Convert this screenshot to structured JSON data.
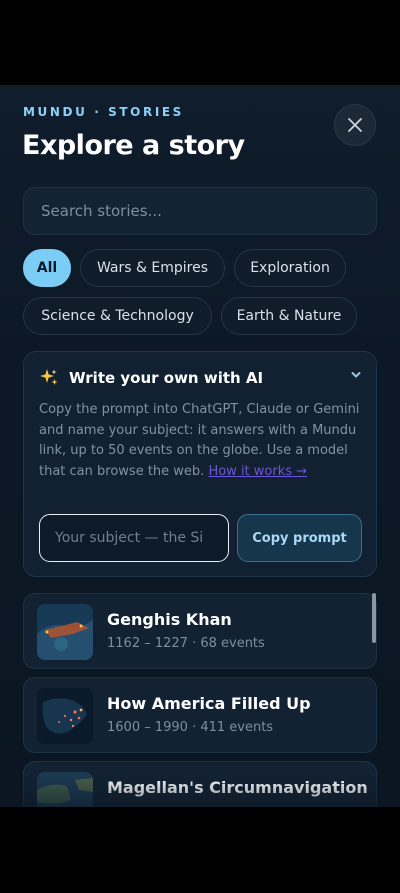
{
  "header": {
    "brand": "MUNDU · STORIES",
    "title": "Explore a story",
    "close_icon": "close-icon"
  },
  "search": {
    "placeholder": "Search stories..."
  },
  "filters": [
    {
      "label": "All",
      "active": true
    },
    {
      "label": "Wars & Empires",
      "active": false
    },
    {
      "label": "Exploration",
      "active": false
    },
    {
      "label": "Science & Technology",
      "active": false
    },
    {
      "label": "Earth & Nature",
      "active": false
    }
  ],
  "ai_card": {
    "icon": "sparkles-icon",
    "title": "Write your own with AI",
    "description": "Copy the prompt into ChatGPT, Claude or Gemini and name your subject: it answers with a Mundu link, up to 50 events on the globe. Use a model that can browse the web.",
    "link_label": "How it works →",
    "subject_placeholder": "Your subject — the Si",
    "copy_label": "Copy prompt",
    "expanded": true
  },
  "stories": [
    {
      "name": "Genghis Khan",
      "meta": "1162 – 1227 · 68 events"
    },
    {
      "name": "How America Filled Up",
      "meta": "1600 – 1990 · 411 events"
    },
    {
      "name": "Magellan's Circumnavigation",
      "meta": ""
    }
  ],
  "colors": {
    "accent": "#7ccdf5",
    "background": "#0c1826",
    "card": "#122232",
    "link": "#6e54d8"
  }
}
